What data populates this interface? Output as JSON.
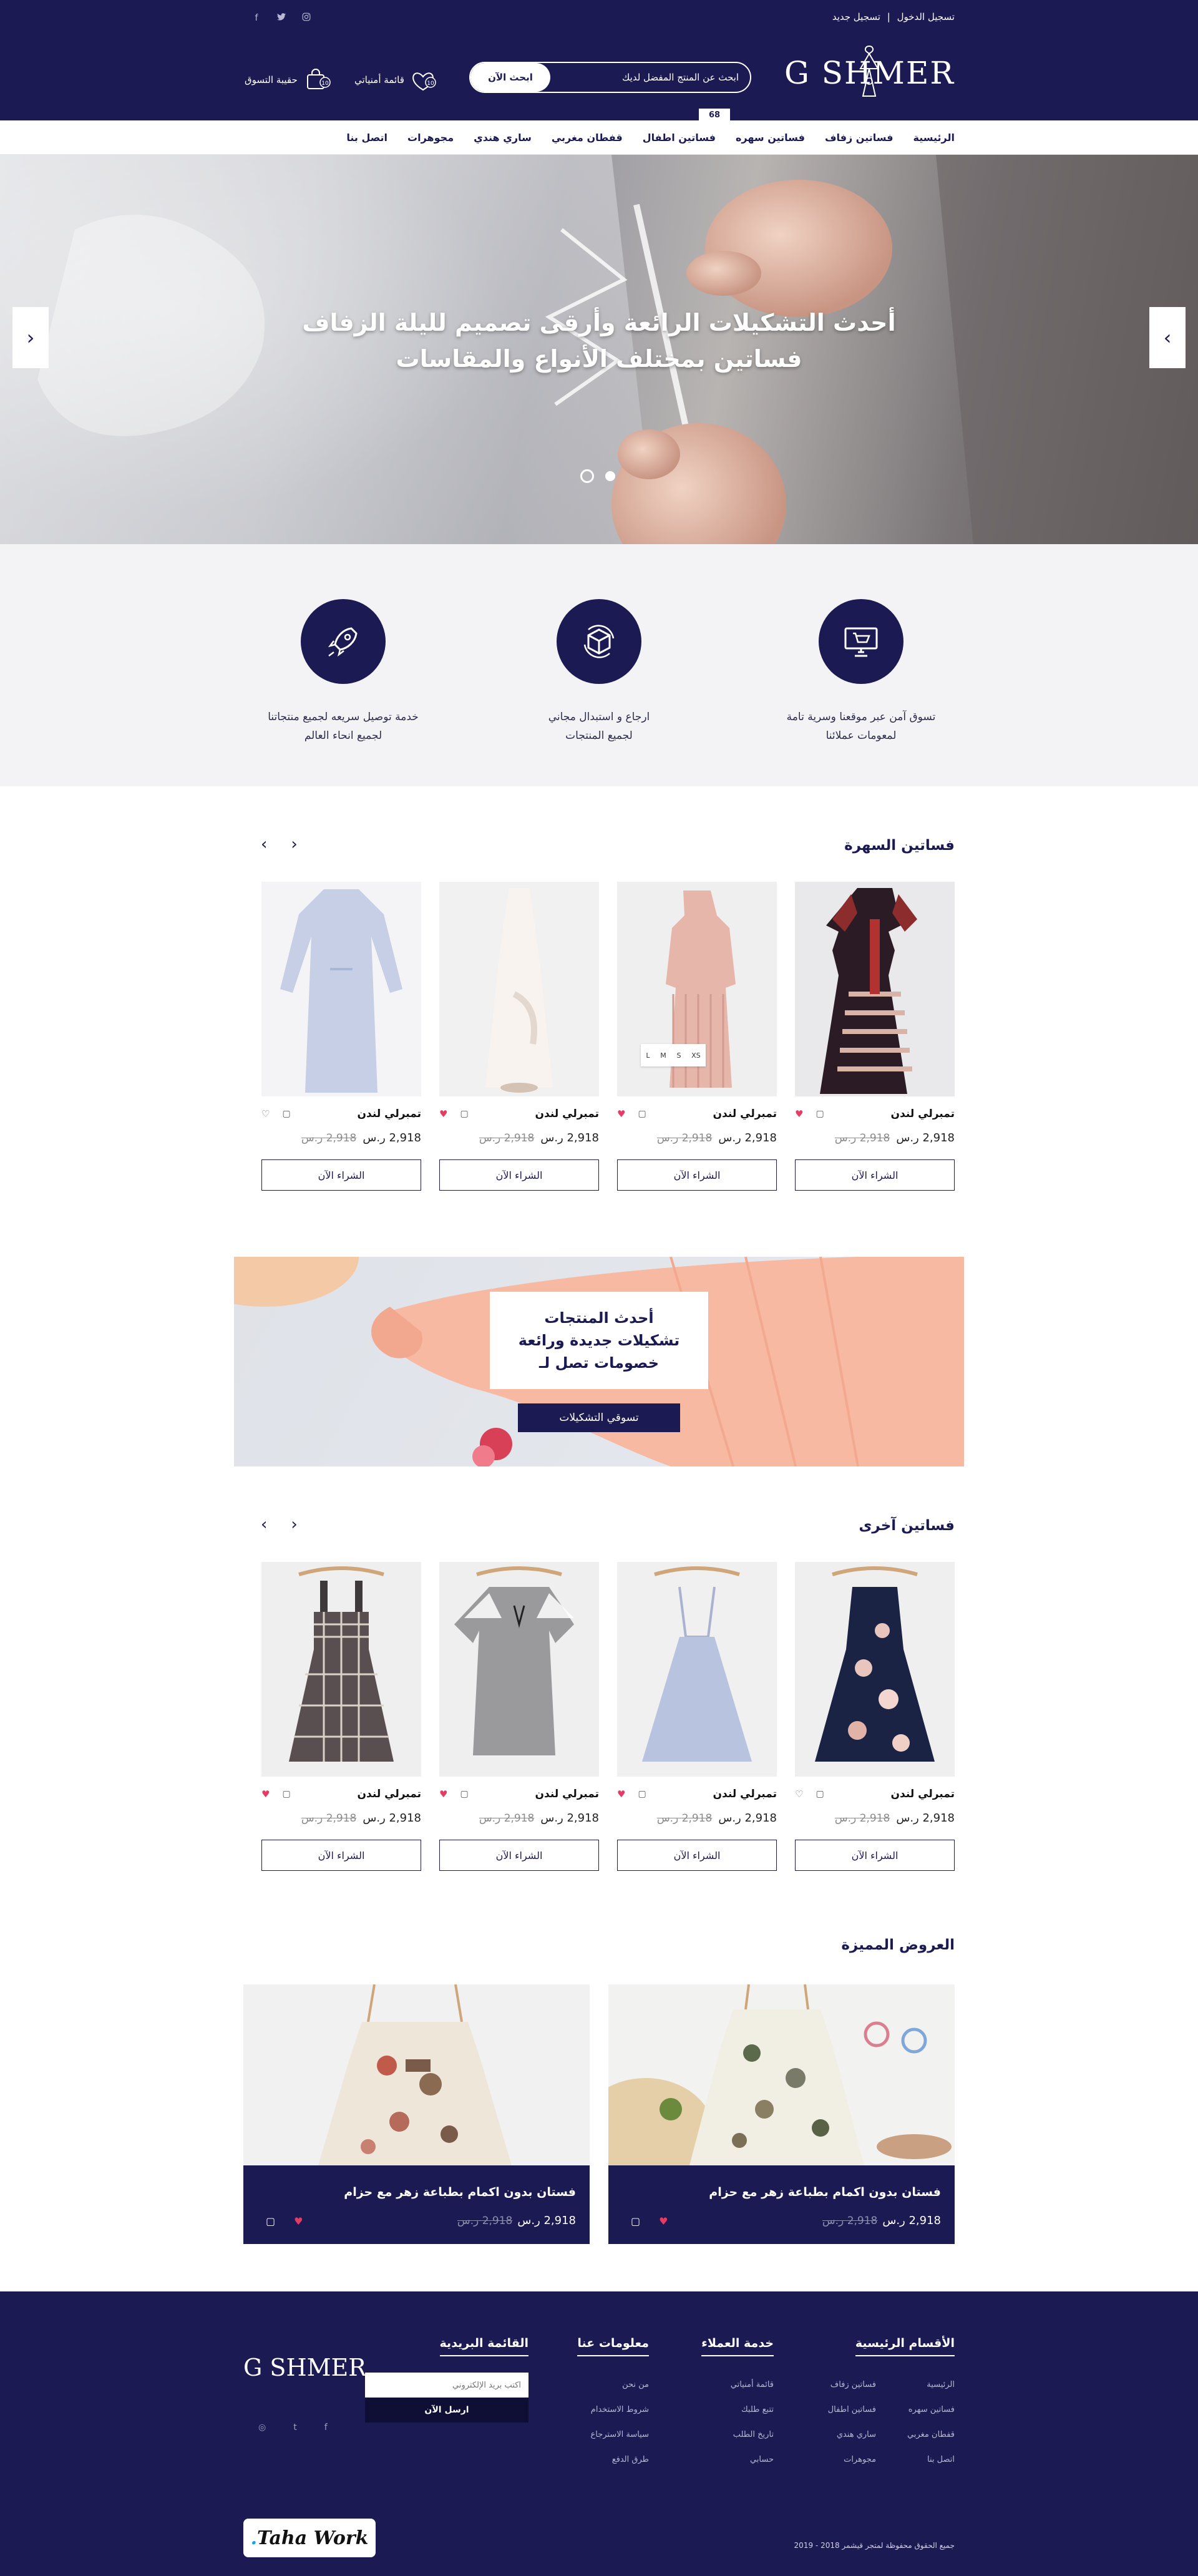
{
  "header": {
    "top_links": {
      "register": "تسجيل جديد",
      "separator": "|",
      "login": "تسجيل الدخول"
    },
    "logo": "G SHMER",
    "search": {
      "placeholder": "ابحث عن المنتج المفضل لديك",
      "button": "ابحث الآن"
    },
    "wishlist_label": "قائمة أمنياتي",
    "cart_label": "حقيبة التسوق",
    "cart_count": "68",
    "social": [
      "facebook-icon",
      "twitter-icon",
      "instagram-icon"
    ]
  },
  "menu": [
    "الرئيسية",
    "فساتين زفاف",
    "فساتين سهره",
    "فساتين اطفال",
    "قفطان مغربي",
    "ساري هندي",
    "مجوهرات",
    "اتصل بنا"
  ],
  "hero": {
    "line1": "أحدث التشكيلات الرائعة وأرقى تصميم لليلة الزفاف",
    "line2": "فساتين بمختلف الأنواع والمقاسات",
    "prev": "‹",
    "next": "›"
  },
  "features": [
    {
      "icon": "monitor-cart-icon",
      "text1": "تسوق آمن عبر موقعنا وسرية تامة",
      "text2": "لمعومات عملائنا"
    },
    {
      "icon": "return-box-icon",
      "text1": "ارجاع و استبدال مجاني",
      "text2": "لجميع المنتجات"
    },
    {
      "icon": "rocket-icon",
      "text1": "خدمة توصيل سريعه لجميع منتجاتنا",
      "text2": "لجميع انحاء العالم"
    }
  ],
  "evening_section": {
    "title": "فساتين السهرة",
    "products": [
      {
        "name": "تمبرلي لندن",
        "price": "2,918 ر.س",
        "old_price": "2,918 ر.س",
        "button": "الشراء الآن",
        "liked": true
      },
      {
        "name": "تمبرلي لندن",
        "price": "2,918 ر.س",
        "old_price": "2,918 ر.س",
        "button": "الشراء الآن",
        "liked": true,
        "sizes": [
          "XS",
          "S",
          "M",
          "L"
        ]
      },
      {
        "name": "تمبرلي لندن",
        "price": "2,918 ر.س",
        "old_price": "2,918 ر.س",
        "button": "الشراء الآن",
        "liked": true
      },
      {
        "name": "تمبرلي لندن",
        "price": "2,918 ر.س",
        "old_price": "2,918 ر.س",
        "button": "الشراء الآن",
        "liked": false
      }
    ]
  },
  "promo": {
    "line1": "أحدث المنتجات",
    "line2": "تشكيلات جديدة ورائعة",
    "line3": "خصومات تصل لـ",
    "button": "تسوقي التشكيلات"
  },
  "other_section": {
    "title": "فساتين آخرى",
    "products": [
      {
        "name": "تمبرلي لندن",
        "price": "2,918 ر.س",
        "old_price": "2,918 ر.س",
        "button": "الشراء الآن",
        "liked": false
      },
      {
        "name": "تمبرلي لندن",
        "price": "2,918 ر.س",
        "old_price": "2,918 ر.س",
        "button": "الشراء الآن",
        "liked": true
      },
      {
        "name": "تمبرلي لندن",
        "price": "2,918 ر.س",
        "old_price": "2,918 ر.س",
        "button": "الشراء الآن",
        "liked": true
      },
      {
        "name": "تمبرلي لندن",
        "price": "2,918 ر.س",
        "old_price": "2,918 ر.س",
        "button": "الشراء الآن",
        "liked": true
      }
    ]
  },
  "featured_section": {
    "title": "العروض المميزة",
    "cards": [
      {
        "title": "فستان بدون اكمام بطباعة زهر مع حزام",
        "price": "2,918 ر.س",
        "old_price": "2,918 ر.س"
      },
      {
        "title": "فستان بدون اكمام بطباعة زهر مع حزام",
        "price": "2,918 ر.س",
        "old_price": "2,918 ر.س"
      }
    ]
  },
  "footer": {
    "sections": {
      "title": "الأقسام الرئيسية",
      "items": [
        "الرئيسية",
        "فساتين زفاف",
        "فساتين سهره",
        "فساتين اطفال",
        "قفطان مغربي",
        "ساري هندي",
        "اتصل بنا",
        "مجوهرات"
      ]
    },
    "customer_service": {
      "title": "خدمة العملاء",
      "items": [
        "قائمة أمنياتي",
        "تتبع طلبك",
        "تاريخ الطلب",
        "حسابي"
      ]
    },
    "about": {
      "title": "معلومات عنا",
      "items": [
        "من نحن",
        "شروط الاستخدام",
        "سياسة الاسترجاع",
        "طرق الدفع"
      ]
    },
    "newsletter": {
      "title": "القائمة البريدية",
      "placeholder": "اكتب بريد الإلكتروني",
      "button": "ارسل الآن"
    },
    "logo": "G SHMER",
    "copyright": "جميع الحقوق محفوظة لمتجر قيشمر 2018 - 2019",
    "badge": {
      "text": "Taha Work",
      "dot": "."
    }
  },
  "colors": {
    "navy": "#1b1a53",
    "heart": "#e63b63",
    "background": "#ffffff"
  }
}
